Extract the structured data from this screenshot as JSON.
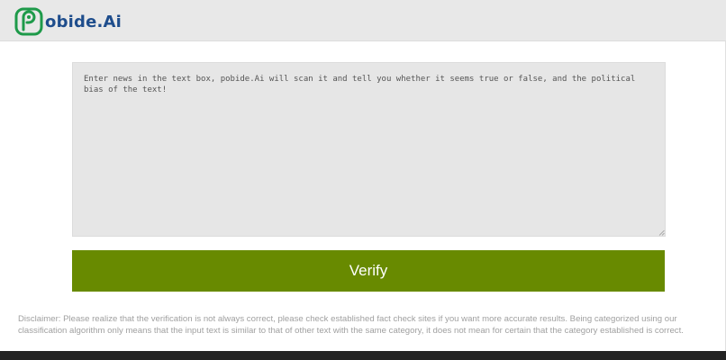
{
  "header": {
    "brand_name": "obide.Ai",
    "logo_icon": "stylized-p-logo-icon",
    "logo_color": "#1e9a4a",
    "brand_color": "#1e4d8c"
  },
  "main": {
    "news_input": {
      "placeholder": "Enter news in the text box, pobide.Ai will scan it and tell you whether it seems true or false, and the political bias of the text!",
      "value": ""
    },
    "verify_button": {
      "label": "Verify",
      "color": "#688a00"
    },
    "disclaimer": "Disclaimer: Please realize that the verification is not always correct, please check established fact check sites if you want more accurate results. Being categorized using our classification algorithm only means that the input text is similar to that of other text with the same category, it does not mean for certain that the category established is correct."
  },
  "colors": {
    "topbar_bg": "#e8e8e8",
    "textarea_bg": "#e6e6e6",
    "footer_bg": "#222222"
  }
}
